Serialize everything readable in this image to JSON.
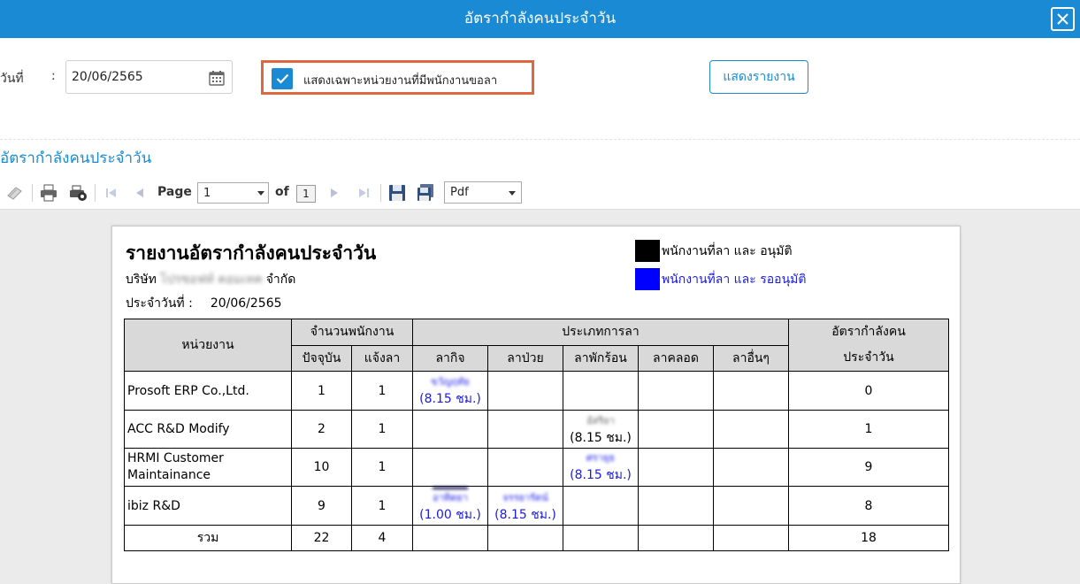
{
  "window": {
    "title": "อัตรากำลังคนประจำวัน"
  },
  "filter": {
    "date_label": "วันที่",
    "colon": ":",
    "date_value": "20/06/2565",
    "checkbox_label": "แสดงเฉพาะหน่วยงานที่มีพนักงานขอลา",
    "show_button": "แสดงรายงาน"
  },
  "section_title": "อัตรากำลังคนประจำวัน",
  "toolbar": {
    "page_label": "Page",
    "page_value": "1",
    "of_label": "of",
    "total_pages": "1",
    "format_value": "Pdf"
  },
  "report": {
    "title": "รายงานอัตรากำลังคนประจำวัน",
    "company_prefix": "บริษัท",
    "company_suffix": "จำกัด",
    "date_label": "ประจำวันที่ :",
    "date_value": "20/06/2565",
    "legend": [
      {
        "label": "พนักงานที่ลา และ อนุมัติ",
        "color": "#000000"
      },
      {
        "label": "พนักงานที่ลา และ รออนุมัติ",
        "color": "#0000ff"
      }
    ],
    "headers": {
      "unit": "หน่วยงาน",
      "employees": "จำนวนพนักงาน",
      "current": "ปัจจุบัน",
      "on_leave": "แจ้งลา",
      "leave_type": "ประเภทการลา",
      "personal": "ลากิจ",
      "sick": "ลาป่วย",
      "vacation": "ลาพักร้อน",
      "maternity": "ลาคลอด",
      "other": "ลาอื่นๆ",
      "rate_line1": "อัตรากำลังคน",
      "rate_line2": "ประจำวัน"
    },
    "rows": [
      {
        "unit": "Prosoft ERP Co.,Ltd.",
        "current": "1",
        "on_leave": "1",
        "personal": "(8.15 ชม.)",
        "sick": "",
        "vacation": "",
        "maternity": "",
        "other": "",
        "rate": "0"
      },
      {
        "unit": "ACC R&D Modify",
        "current": "2",
        "on_leave": "1",
        "personal": "",
        "sick": "",
        "vacation": "(8.15 ชม.)",
        "maternity": "",
        "other": "",
        "rate": "1"
      },
      {
        "unit": "HRMI Customer Maintainance",
        "current": "10",
        "on_leave": "1",
        "personal": "",
        "sick": "",
        "vacation": "(8.15 ชม.)",
        "maternity": "",
        "other": "",
        "rate": "9"
      },
      {
        "unit": "ibiz R&D",
        "current": "9",
        "on_leave": "1",
        "personal": "(1.00 ชม.)",
        "sick": "(8.15 ชม.)",
        "vacation": "",
        "maternity": "",
        "other": "",
        "rate": "8"
      }
    ],
    "total": {
      "label": "รวม",
      "current": "22",
      "on_leave": "4",
      "rate": "18"
    }
  },
  "colors": {
    "accent": "#1a8ad4",
    "highlight_border": "#e0683f",
    "approved": "#000000",
    "pending": "#1a1ae6"
  },
  "icons": [
    "close-icon",
    "calendar-icon",
    "check-icon",
    "print-icon",
    "first-page-icon",
    "prev-page-icon",
    "next-page-icon",
    "last-page-icon",
    "save-icon",
    "export-icon"
  ]
}
